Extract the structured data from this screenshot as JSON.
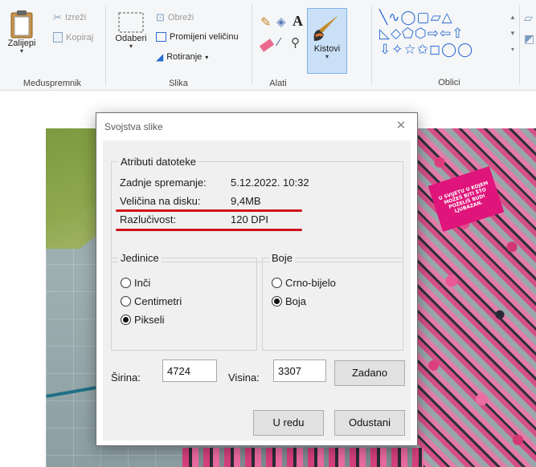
{
  "ribbon": {
    "clipboard": {
      "paste_label": "Zalijepi",
      "cut_label": "Izreži",
      "copy_label": "Kopiraj",
      "group_label": "Međuspremnik"
    },
    "image": {
      "select_label": "Odaberi",
      "crop_label": "Obreži",
      "resize_label": "Promijeni veličinu",
      "rotate_label": "Rotiranje",
      "group_label": "Slika"
    },
    "tools": {
      "group_label": "Alati",
      "text_tool_glyph": "A"
    },
    "brushes": {
      "label": "Kistovi"
    },
    "shapes": {
      "group_label": "Oblici",
      "row1": "╲∿◯▢▱△",
      "row2": "◺◇⬠⬡⇨⇦⇧",
      "row3": "⇩✧☆✩◻◯◯"
    }
  },
  "photo": {
    "banner_text": "U SVIJETU U KOJEM MOŽEŠ BITI ŠTO POŽELIŠ BUDI LJUBAZAN."
  },
  "dialog": {
    "title": "Svojstva slike",
    "close_glyph": "✕",
    "attributes": {
      "legend": "Atributi datoteke",
      "modified_label": "Zadnje spremanje:",
      "modified_value": "5.12.2022. 10:32",
      "size_label": "Veličina na disku:",
      "size_value": "9,4MB",
      "resolution_label": "Razlučivost:",
      "resolution_value": "120 DPI"
    },
    "units": {
      "legend": "Jedinice",
      "options": [
        "Inči",
        "Centimetri",
        "Pikseli"
      ],
      "selected": "Pikseli"
    },
    "colors": {
      "legend": "Boje",
      "options": [
        "Crno-bijelo",
        "Boja"
      ],
      "selected": "Boja"
    },
    "width_label": "Širina:",
    "width_value": "4724",
    "height_label": "Visina:",
    "height_value": "3307",
    "default_button": "Zadano",
    "ok_button": "U redu",
    "cancel_button": "Odustani",
    "highlight_color": "#d0101a"
  }
}
